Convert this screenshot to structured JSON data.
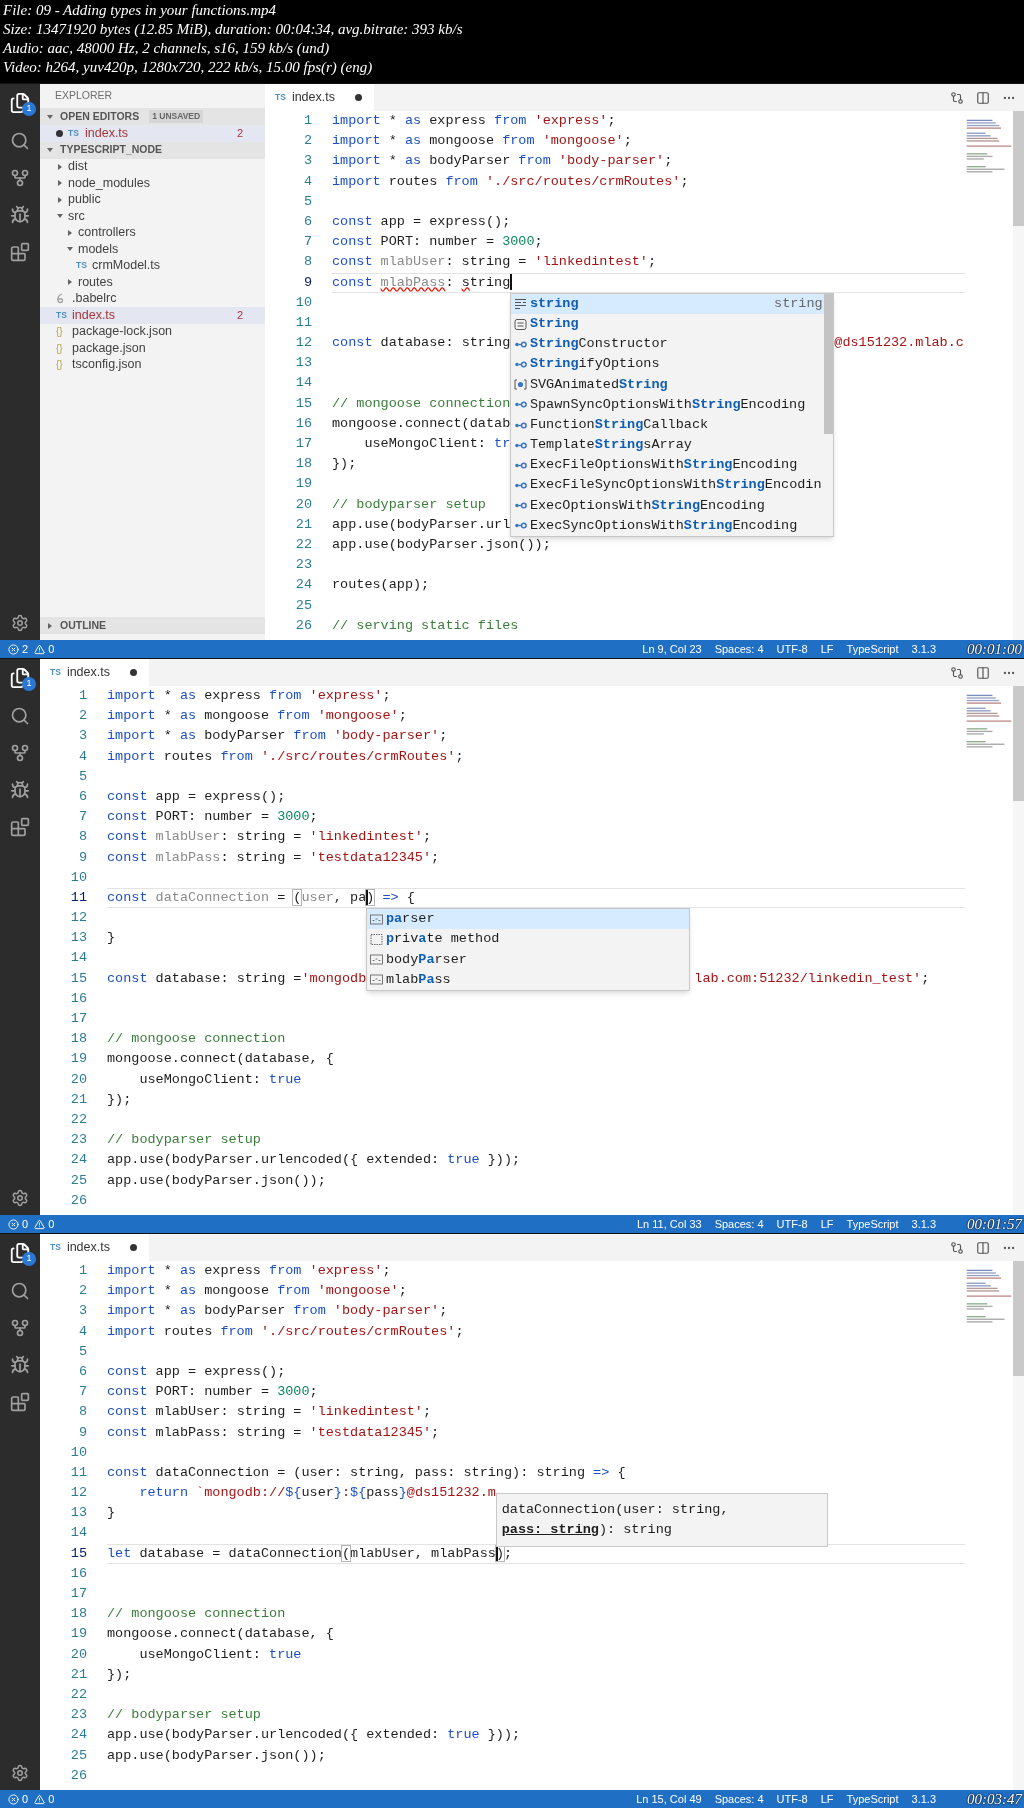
{
  "file_info": [
    "File: 09 - Adding types in your functions.mp4",
    "Size: 13471920 bytes (12.85 MiB), duration: 00:04:34, avg.bitrate: 393 kb/s",
    "Audio: aac, 48000 Hz, 2 channels, s16, 159 kb/s (und)",
    "Video: h264, yuv420p, 1280x720, 222 kb/s, 15.00 fps(r) (eng)"
  ],
  "frames": [
    {
      "activity_badge": "1",
      "sidebar": {
        "title": "EXPLORER",
        "sections": [
          {
            "kind": "open_editors",
            "title": "OPEN EDITORS",
            "expanded": true,
            "badge": "1 UNSAVED",
            "items": [
              {
                "label": "index.ts",
                "icon": {
                  "kind": "ts",
                  "text": "TS"
                },
                "dirty": true,
                "errors": "2",
                "selected": true
              }
            ]
          },
          {
            "kind": "tree",
            "title": "TYPESCRIPT_NODE",
            "expanded": true,
            "items": [
              {
                "label": "dist",
                "kind": "folder",
                "expanded": false,
                "selected": false
              },
              {
                "label": "node_modules",
                "kind": "folder",
                "expanded": false,
                "selected": false
              },
              {
                "label": "public",
                "kind": "folder",
                "expanded": false,
                "selected": false
              },
              {
                "label": "src",
                "kind": "folder",
                "expanded": true,
                "selected": false,
                "children": [
                  {
                    "label": "controllers",
                    "kind": "folder",
                    "expanded": false,
                    "selected": false
                  },
                  {
                    "label": "models",
                    "kind": "folder",
                    "expanded": true,
                    "selected": false,
                    "children": [
                      {
                        "label": "crmModel.ts",
                        "kind": "file",
                        "icon": {
                          "kind": "ts",
                          "text": "TS"
                        },
                        "selected": false
                      }
                    ]
                  },
                  {
                    "label": "routes",
                    "kind": "folder",
                    "expanded": false,
                    "selected": false
                  }
                ]
              },
              {
                "label": ".babelrc",
                "kind": "file",
                "icon": {
                  "kind": "babel"
                },
                "selected": false
              },
              {
                "label": "index.ts",
                "kind": "file",
                "icon": {
                  "kind": "ts",
                  "text": "TS"
                },
                "errors": "2",
                "selected": true
              },
              {
                "label": "package-lock.json",
                "kind": "file",
                "icon": {
                  "kind": "json",
                  "text": "{}"
                },
                "selected": false
              },
              {
                "label": "package.json",
                "kind": "file",
                "icon": {
                  "kind": "json",
                  "text": "{}"
                },
                "selected": false
              },
              {
                "label": "tsconfig.json",
                "kind": "file",
                "icon": {
                  "kind": "json",
                  "text": "{}"
                },
                "selected": false
              }
            ]
          },
          {
            "kind": "outline",
            "title": "OUTLINE",
            "expanded": false
          }
        ]
      },
      "tab": {
        "label": "index.ts",
        "icon_text": "TS",
        "dirty": true
      },
      "lines": [
        {
          "number": "1",
          "current": false,
          "tokens": [
            {
              "kind": "keyword",
              "text": "import"
            },
            " * ",
            {
              "kind": "keyword",
              "text": "as"
            },
            " express ",
            {
              "kind": "keyword",
              "text": "from"
            },
            {
              "kind": "string",
              "text": " 'express'"
            },
            ";"
          ]
        },
        {
          "number": "2",
          "current": false,
          "tokens": [
            {
              "kind": "keyword",
              "text": "import"
            },
            " * ",
            {
              "kind": "keyword",
              "text": "as"
            },
            " mongoose ",
            {
              "kind": "keyword",
              "text": "from"
            },
            {
              "kind": "string",
              "text": " 'mongoose'"
            },
            ";"
          ]
        },
        {
          "number": "3",
          "current": false,
          "tokens": [
            {
              "kind": "keyword",
              "text": "import"
            },
            " * ",
            {
              "kind": "keyword",
              "text": "as"
            },
            " bodyParser ",
            {
              "kind": "keyword",
              "text": "from"
            },
            {
              "kind": "string",
              "text": " 'body-parser'"
            },
            ";"
          ]
        },
        {
          "number": "4",
          "current": false,
          "tokens": [
            {
              "kind": "keyword",
              "text": "import"
            },
            " routes ",
            {
              "kind": "keyword",
              "text": "from"
            },
            {
              "kind": "string",
              "text": " './src/routes/crmRoutes'"
            },
            ";"
          ]
        },
        {
          "number": "5",
          "current": false
        },
        {
          "number": "6",
          "current": false,
          "tokens": [
            {
              "kind": "keyword",
              "text": "const"
            },
            " app = express();"
          ]
        },
        {
          "number": "7",
          "current": false,
          "tokens": [
            {
              "kind": "keyword",
              "text": "const"
            },
            " PORT: number = ",
            {
              "kind": "number",
              "text": "3000"
            },
            ";"
          ]
        },
        {
          "number": "8",
          "current": false,
          "tokens": [
            {
              "kind": "keyword",
              "text": "const "
            },
            {
              "kind": "unused",
              "text": "mlabUser"
            },
            ": string = ",
            {
              "kind": "string",
              "text": "'linkedintest'"
            },
            ";"
          ]
        },
        {
          "number": "9",
          "current": true,
          "tokens": [
            {
              "kind": "keyword",
              "text": "const "
            },
            {
              "kind": "error_unused",
              "text": "mlabPass"
            },
            ": ",
            {
              "kind": "error",
              "text": "s"
            },
            "tring",
            {
              "kind": "cursor"
            }
          ]
        },
        {
          "number": "10",
          "current": false
        },
        {
          "number": "11",
          "current": false
        },
        {
          "number": "12",
          "current": false,
          "tokens": [
            {
              "kind": "keyword",
              "text": "const"
            },
            " database: string"
          ],
          "tail": [
            {
              "kind": "string",
              "text": "@ds151232.mlab.c"
            }
          ]
        },
        {
          "number": "13",
          "current": false
        },
        {
          "number": "14",
          "current": false
        },
        {
          "number": "15",
          "current": false,
          "tokens": [
            {
              "kind": "comment",
              "text": "// mongoose connection"
            }
          ]
        },
        {
          "number": "16",
          "current": false,
          "tokens": [
            "mongoose.connect(datab"
          ]
        },
        {
          "number": "17",
          "current": false,
          "tokens": [
            "    useMongoClient: ",
            {
              "kind": "keyword",
              "text": "tr"
            }
          ]
        },
        {
          "number": "18",
          "current": false,
          "tokens": [
            "});"
          ]
        },
        {
          "number": "19",
          "current": false
        },
        {
          "number": "20",
          "current": false,
          "tokens": [
            {
              "kind": "comment",
              "text": "// bodyparser setup"
            }
          ]
        },
        {
          "number": "21",
          "current": false,
          "tokens": [
            "app.use(bodyParser.url"
          ]
        },
        {
          "number": "22",
          "current": false,
          "tokens": [
            "app.use(bodyParser.json());"
          ]
        },
        {
          "number": "23",
          "current": false
        },
        {
          "number": "24",
          "current": false,
          "tokens": [
            "routes(app);"
          ]
        },
        {
          "number": "25",
          "current": false
        },
        {
          "number": "26",
          "current": false,
          "tokens": [
            {
              "kind": "comment",
              "text": "// serving static files"
            }
          ]
        }
      ],
      "suggestions": {
        "scrollable": true,
        "items": [
          {
            "kind": "keyword",
            "selected": true,
            "parts": [
              {
                "text": "string",
                "match": true
              }
            ],
            "detail": "string"
          },
          {
            "kind": "module",
            "selected": false,
            "parts": [
              {
                "text": "String",
                "match": true
              }
            ]
          },
          {
            "kind": "interface",
            "selected": false,
            "parts": [
              {
                "text": "String",
                "match": true
              },
              {
                "text": "Constructor",
                "match": false
              }
            ]
          },
          {
            "kind": "interface",
            "selected": false,
            "parts": [
              {
                "text": "String",
                "match": true
              },
              {
                "text": "ifyOptions",
                "match": false
              }
            ]
          },
          {
            "kind": "field",
            "selected": false,
            "parts": [
              {
                "text": "SVGAnimated",
                "match": false
              },
              {
                "text": "String",
                "match": true
              }
            ]
          },
          {
            "kind": "interface",
            "selected": false,
            "parts": [
              {
                "text": "SpawnSyncOptionsWith",
                "match": false
              },
              {
                "text": "String",
                "match": true
              },
              {
                "text": "Encoding",
                "match": false
              }
            ]
          },
          {
            "kind": "interface",
            "selected": false,
            "parts": [
              {
                "text": "Function",
                "match": false
              },
              {
                "text": "String",
                "match": true
              },
              {
                "text": "Callback",
                "match": false
              }
            ]
          },
          {
            "kind": "interface",
            "selected": false,
            "parts": [
              {
                "text": "Template",
                "match": false
              },
              {
                "text": "String",
                "match": true
              },
              {
                "text": "sArray",
                "match": false
              }
            ]
          },
          {
            "kind": "interface",
            "selected": false,
            "parts": [
              {
                "text": "ExecFileOptionsWith",
                "match": false
              },
              {
                "text": "String",
                "match": true
              },
              {
                "text": "Encoding",
                "match": false
              }
            ]
          },
          {
            "kind": "interface",
            "selected": false,
            "parts": [
              {
                "text": "ExecFileSyncOptionsWith",
                "match": false
              },
              {
                "text": "String",
                "match": true
              },
              {
                "text": "Encodin",
                "match": false
              }
            ]
          },
          {
            "kind": "interface",
            "selected": false,
            "parts": [
              {
                "text": "ExecOptionsWith",
                "match": false
              },
              {
                "text": "String",
                "match": true
              },
              {
                "text": "Encoding",
                "match": false
              }
            ]
          },
          {
            "kind": "interface",
            "selected": false,
            "parts": [
              {
                "text": "ExecSyncOptionsWith",
                "match": false
              },
              {
                "text": "String",
                "match": true
              },
              {
                "text": "Encoding",
                "match": false
              }
            ]
          }
        ]
      },
      "status_bar": {
        "errors": "2",
        "warnings": "0",
        "items": [
          "Ln 9, Col 23",
          "Spaces: 4",
          "UTF-8",
          "LF",
          "TypeScript",
          "3.1.3"
        ]
      },
      "timestamp": "00:01:00"
    },
    {
      "activity_badge": "1",
      "tab": {
        "label": "index.ts",
        "icon_text": "TS",
        "dirty": true
      },
      "lines": [
        {
          "number": "1",
          "current": false,
          "tokens": [
            {
              "kind": "keyword",
              "text": "import"
            },
            " * ",
            {
              "kind": "keyword",
              "text": "as"
            },
            " express ",
            {
              "kind": "keyword",
              "text": "from"
            },
            {
              "kind": "string",
              "text": " 'express'"
            },
            ";"
          ]
        },
        {
          "number": "2",
          "current": false,
          "tokens": [
            {
              "kind": "keyword",
              "text": "import"
            },
            " * ",
            {
              "kind": "keyword",
              "text": "as"
            },
            " mongoose ",
            {
              "kind": "keyword",
              "text": "from"
            },
            {
              "kind": "string",
              "text": " 'mongoose'"
            },
            ";"
          ]
        },
        {
          "number": "3",
          "current": false,
          "tokens": [
            {
              "kind": "keyword",
              "text": "import"
            },
            " * ",
            {
              "kind": "keyword",
              "text": "as"
            },
            " bodyParser ",
            {
              "kind": "keyword",
              "text": "from"
            },
            {
              "kind": "string",
              "text": " 'body-parser'"
            },
            ";"
          ]
        },
        {
          "number": "4",
          "current": false,
          "tokens": [
            {
              "kind": "keyword",
              "text": "import"
            },
            " routes ",
            {
              "kind": "keyword",
              "text": "from"
            },
            {
              "kind": "string",
              "text": " './src/routes/crmRoutes'"
            },
            ";"
          ]
        },
        {
          "number": "5",
          "current": false
        },
        {
          "number": "6",
          "current": false,
          "tokens": [
            {
              "kind": "keyword",
              "text": "const"
            },
            " app = express();"
          ]
        },
        {
          "number": "7",
          "current": false,
          "tokens": [
            {
              "kind": "keyword",
              "text": "const"
            },
            " PORT: number = ",
            {
              "kind": "number",
              "text": "3000"
            },
            ";"
          ]
        },
        {
          "number": "8",
          "current": false,
          "tokens": [
            {
              "kind": "keyword",
              "text": "const "
            },
            {
              "kind": "unused",
              "text": "mlabUser"
            },
            ": string = ",
            {
              "kind": "string",
              "text": "'linkedintest'"
            },
            ";"
          ]
        },
        {
          "number": "9",
          "current": false,
          "tokens": [
            {
              "kind": "keyword",
              "text": "const "
            },
            {
              "kind": "unused",
              "text": "mlabPass"
            },
            ": string = ",
            {
              "kind": "string",
              "text": "'testdata12345'"
            },
            ";"
          ]
        },
        {
          "number": "10",
          "current": false
        },
        {
          "number": "11",
          "current": true,
          "tokens": [
            {
              "kind": "keyword",
              "text": "const "
            },
            {
              "kind": "unused",
              "text": "dataConnection"
            },
            " = ",
            {
              "kind": "bracket",
              "text": "("
            },
            {
              "kind": "unused",
              "text": "user"
            },
            ", pa",
            {
              "kind": "cursor"
            },
            {
              "kind": "bracket",
              "text": ")"
            },
            {
              "kind": "keyword",
              "text": " =>"
            },
            " {"
          ]
        },
        {
          "number": "12",
          "current": false
        },
        {
          "number": "13",
          "current": false,
          "tokens": [
            "}"
          ]
        },
        {
          "number": "14",
          "current": false
        },
        {
          "number": "15",
          "current": false,
          "tokens": [
            {
              "kind": "keyword",
              "text": "const"
            },
            " database: string =",
            {
              "kind": "string",
              "text": "'mongodb"
            }
          ],
          "tail": [
            {
              "kind": "string",
              "text": "lab.com:51232/linkedin_test'"
            },
            ";"
          ]
        },
        {
          "number": "16",
          "current": false
        },
        {
          "number": "17",
          "current": false
        },
        {
          "number": "18",
          "current": false,
          "tokens": [
            {
              "kind": "comment",
              "text": "// mongoose connection"
            }
          ]
        },
        {
          "number": "19",
          "current": false,
          "tokens": [
            "mongoose.connect(database, {"
          ]
        },
        {
          "number": "20",
          "current": false,
          "tokens": [
            "    useMongoClient: ",
            {
              "kind": "keyword",
              "text": "true"
            }
          ]
        },
        {
          "number": "21",
          "current": false,
          "tokens": [
            "});"
          ]
        },
        {
          "number": "22",
          "current": false
        },
        {
          "number": "23",
          "current": false,
          "tokens": [
            {
              "kind": "comment",
              "text": "// bodyparser setup"
            }
          ]
        },
        {
          "number": "24",
          "current": false,
          "tokens": [
            "app.use(bodyParser.urlencoded({ extended: ",
            {
              "kind": "keyword",
              "text": "true"
            },
            " }));"
          ]
        },
        {
          "number": "25",
          "current": false,
          "tokens": [
            "app.use(bodyParser.json());"
          ]
        },
        {
          "number": "26",
          "current": false
        }
      ],
      "suggestions": {
        "scrollable": false,
        "items": [
          {
            "kind": "word",
            "selected": true,
            "parts": [
              {
                "text": "pa",
                "match": true
              },
              {
                "text": "rser",
                "match": false
              }
            ]
          },
          {
            "kind": "snippet",
            "selected": false,
            "parts": [
              {
                "text": "p",
                "match": true
              },
              {
                "text": "riv",
                "match": false
              },
              {
                "text": "a",
                "match": true
              },
              {
                "text": "te method",
                "match": false
              }
            ]
          },
          {
            "kind": "word",
            "selected": false,
            "parts": [
              {
                "text": "body",
                "match": false
              },
              {
                "text": "Pa",
                "match": true
              },
              {
                "text": "rser",
                "match": false
              }
            ]
          },
          {
            "kind": "word",
            "selected": false,
            "parts": [
              {
                "text": "mlab",
                "match": false
              },
              {
                "text": "Pa",
                "match": true
              },
              {
                "text": "ss",
                "match": false
              }
            ]
          }
        ]
      },
      "status_bar": {
        "errors": "0",
        "warnings": "0",
        "items": [
          "Ln 11, Col 33",
          "Spaces: 4",
          "UTF-8",
          "LF",
          "TypeScript",
          "3.1.3"
        ]
      },
      "timestamp": "00:01:57"
    },
    {
      "activity_badge": "1",
      "tab": {
        "label": "index.ts",
        "icon_text": "TS",
        "dirty": true
      },
      "lines": [
        {
          "number": "1",
          "current": false,
          "tokens": [
            {
              "kind": "keyword",
              "text": "import"
            },
            " * ",
            {
              "kind": "keyword",
              "text": "as"
            },
            " express ",
            {
              "kind": "keyword",
              "text": "from"
            },
            {
              "kind": "string",
              "text": " 'express'"
            },
            ";"
          ]
        },
        {
          "number": "2",
          "current": false,
          "tokens": [
            {
              "kind": "keyword",
              "text": "import"
            },
            " * ",
            {
              "kind": "keyword",
              "text": "as"
            },
            " mongoose ",
            {
              "kind": "keyword",
              "text": "from"
            },
            {
              "kind": "string",
              "text": " 'mongoose'"
            },
            ";"
          ]
        },
        {
          "number": "3",
          "current": false,
          "tokens": [
            {
              "kind": "keyword",
              "text": "import"
            },
            " * ",
            {
              "kind": "keyword",
              "text": "as"
            },
            " bodyParser ",
            {
              "kind": "keyword",
              "text": "from"
            },
            {
              "kind": "string",
              "text": " 'body-parser'"
            },
            ";"
          ]
        },
        {
          "number": "4",
          "current": false,
          "tokens": [
            {
              "kind": "keyword",
              "text": "import"
            },
            " routes ",
            {
              "kind": "keyword",
              "text": "from"
            },
            {
              "kind": "string",
              "text": " './src/routes/crmRoutes'"
            },
            ";"
          ]
        },
        {
          "number": "5",
          "current": false
        },
        {
          "number": "6",
          "current": false,
          "tokens": [
            {
              "kind": "keyword",
              "text": "const"
            },
            " app = express();"
          ]
        },
        {
          "number": "7",
          "current": false,
          "tokens": [
            {
              "kind": "keyword",
              "text": "const"
            },
            " PORT: number = ",
            {
              "kind": "number",
              "text": "3000"
            },
            ";"
          ]
        },
        {
          "number": "8",
          "current": false,
          "tokens": [
            {
              "kind": "keyword",
              "text": "const"
            },
            " mlabUser: string = ",
            {
              "kind": "string",
              "text": "'linkedintest'"
            },
            ";"
          ]
        },
        {
          "number": "9",
          "current": false,
          "tokens": [
            {
              "kind": "keyword",
              "text": "const"
            },
            " mlabPass: string = ",
            {
              "kind": "string",
              "text": "'testdata12345'"
            },
            ";"
          ]
        },
        {
          "number": "10",
          "current": false
        },
        {
          "number": "11",
          "current": false,
          "tokens": [
            {
              "kind": "keyword",
              "text": "const"
            },
            " dataConnection = (user: string, pass: string): string ",
            {
              "kind": "keyword",
              "text": "=>"
            },
            " {"
          ]
        },
        {
          "number": "12",
          "current": false,
          "tokens": [
            {
              "kind": "keyword",
              "text": "    return"
            },
            {
              "kind": "string",
              "text": " `mongodb://"
            },
            {
              "kind": "keyword",
              "text": "${"
            },
            "user",
            {
              "kind": "keyword",
              "text": "}"
            },
            {
              "kind": "string",
              "text": ":"
            },
            {
              "kind": "keyword",
              "text": "${"
            },
            "pass",
            {
              "kind": "keyword",
              "text": "}"
            },
            {
              "kind": "string",
              "text": "@ds151232.m"
            }
          ]
        },
        {
          "number": "13",
          "current": false,
          "tokens": [
            "}"
          ]
        },
        {
          "number": "14",
          "current": false
        },
        {
          "number": "15",
          "current": true,
          "tokens": [
            {
              "kind": "keyword",
              "text": "let"
            },
            " database = dataConnection",
            {
              "kind": "bracket",
              "text": "("
            },
            "mlabUser, mlabPass",
            {
              "kind": "cursor"
            },
            {
              "kind": "bracket",
              "text": ")"
            },
            ";"
          ]
        },
        {
          "number": "16",
          "current": false
        },
        {
          "number": "17",
          "current": false
        },
        {
          "number": "18",
          "current": false,
          "tokens": [
            {
              "kind": "comment",
              "text": "// mongoose connection"
            }
          ]
        },
        {
          "number": "19",
          "current": false,
          "tokens": [
            "mongoose.connect(database, {"
          ]
        },
        {
          "number": "20",
          "current": false,
          "tokens": [
            "    useMongoClient: ",
            {
              "kind": "keyword",
              "text": "true"
            }
          ]
        },
        {
          "number": "21",
          "current": false,
          "tokens": [
            "});"
          ]
        },
        {
          "number": "22",
          "current": false
        },
        {
          "number": "23",
          "current": false,
          "tokens": [
            {
              "kind": "comment",
              "text": "// bodyparser setup"
            }
          ]
        },
        {
          "number": "24",
          "current": false,
          "tokens": [
            "app.use(bodyParser.urlencoded({ extended: ",
            {
              "kind": "keyword",
              "text": "true"
            },
            " }));"
          ]
        },
        {
          "number": "25",
          "current": false,
          "tokens": [
            "app.use(bodyParser.json());"
          ]
        },
        {
          "number": "26",
          "current": false
        }
      ],
      "parameter_hint": {
        "parts": [
          {
            "text": "dataConnection(user: string, ",
            "active": false
          },
          {
            "text": "pass: string",
            "active": true
          },
          {
            "text": "): string",
            "active": false
          }
        ]
      },
      "status_bar": {
        "errors": "0",
        "warnings": "0",
        "items": [
          "Ln 15, Col 49",
          "Spaces: 4",
          "UTF-8",
          "LF",
          "TypeScript",
          "3.1.3"
        ]
      },
      "timestamp": "00:03:47"
    }
  ]
}
